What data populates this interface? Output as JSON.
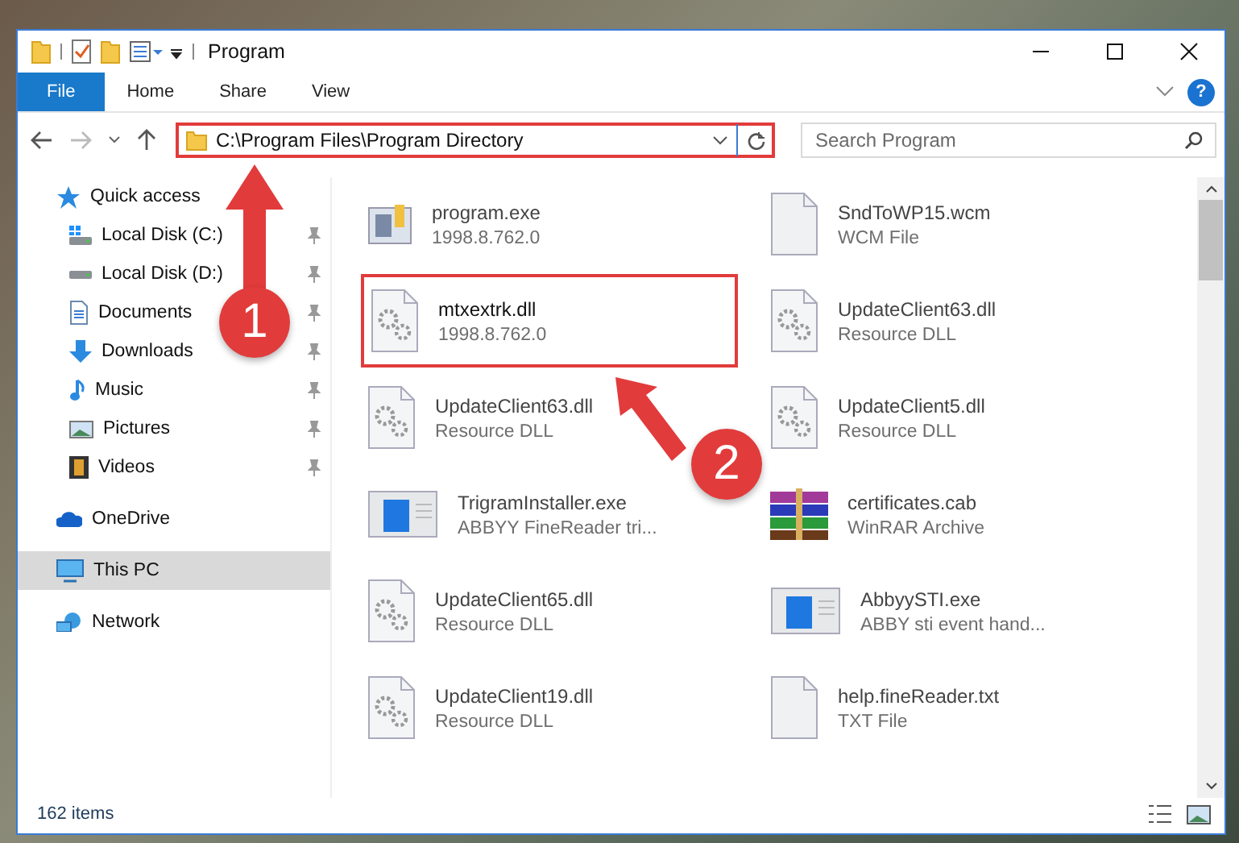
{
  "window": {
    "title": "Program",
    "help_label": "?",
    "menu_tabs": [
      {
        "label": "File",
        "selected": true
      },
      {
        "label": "Home",
        "selected": false
      },
      {
        "label": "Share",
        "selected": false
      },
      {
        "label": "View",
        "selected": false
      }
    ]
  },
  "address_bar": {
    "path": "C:\\Program Files\\Program Directory",
    "highlighted": true
  },
  "search": {
    "placeholder": "Search Program"
  },
  "sidebar": {
    "items": [
      {
        "label": "Quick access",
        "selected": false,
        "children": [
          {
            "label": "Local Disk (C:)",
            "pinned": true,
            "selected": false
          },
          {
            "label": "Local Disk (D:)",
            "pinned": true,
            "selected": false
          },
          {
            "label": "Documents",
            "pinned": true,
            "selected": false
          },
          {
            "label": "Downloads",
            "pinned": true,
            "selected": false
          },
          {
            "label": "Music",
            "pinned": true,
            "selected": false
          },
          {
            "label": "Pictures",
            "pinned": true,
            "selected": false
          },
          {
            "label": "Videos",
            "pinned": true,
            "selected": false
          }
        ]
      },
      {
        "label": "OneDrive",
        "selected": false
      },
      {
        "label": "This PC",
        "selected": true
      },
      {
        "label": "Network",
        "selected": false
      }
    ]
  },
  "files": [
    {
      "name": "program.exe",
      "detail": "1998.8.762.0",
      "kind": "program",
      "highlighted": false
    },
    {
      "name": "SndToWP15.wcm",
      "detail": "WCM File",
      "kind": "document",
      "highlighted": false
    },
    {
      "name": "mtxextrk.dll",
      "detail": "1998.8.762.0",
      "kind": "library",
      "highlighted": true
    },
    {
      "name": "UpdateClient63.dll",
      "detail": "Resource DLL",
      "kind": "library",
      "highlighted": false
    },
    {
      "name": "UpdateClient63.dll",
      "detail": "Resource DLL",
      "kind": "library",
      "highlighted": false
    },
    {
      "name": "UpdateClient5.dll",
      "detail": "Resource DLL",
      "kind": "library",
      "highlighted": false
    },
    {
      "name": "TrigramInstaller.exe",
      "detail": "ABBYY FineReader tri...",
      "kind": "application",
      "highlighted": false
    },
    {
      "name": "certificates.cab",
      "detail": "WinRAR Archive",
      "kind": "archive",
      "highlighted": false
    },
    {
      "name": "UpdateClient65.dll",
      "detail": "Resource DLL",
      "kind": "library",
      "highlighted": false
    },
    {
      "name": "AbbyySTI.exe",
      "detail": "ABBY sti event hand...",
      "kind": "application",
      "highlighted": false
    },
    {
      "name": "UpdateClient19.dll",
      "detail": "Resource DLL",
      "kind": "library",
      "highlighted": false
    },
    {
      "name": "help.fineReader.txt",
      "detail": "TXT File",
      "kind": "document",
      "highlighted": false
    }
  ],
  "status_bar": {
    "count": "162 items"
  },
  "annotations": [
    {
      "number": "1"
    },
    {
      "number": "2"
    }
  ]
}
